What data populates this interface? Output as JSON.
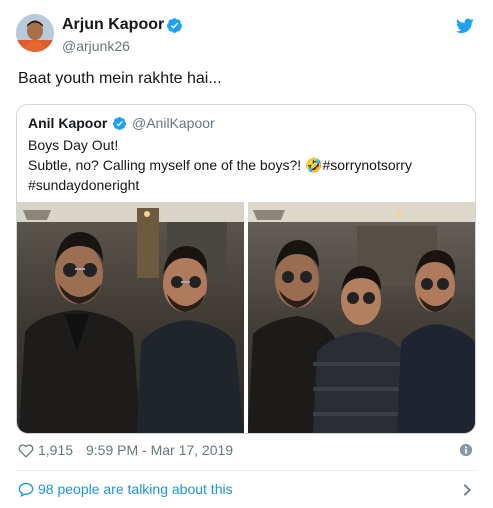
{
  "author": {
    "name": "Arjun Kapoor",
    "handle": "@arjunk26"
  },
  "tweet": {
    "text": "Baat youth mein rakhte hai..."
  },
  "quoted": {
    "name": "Anil Kapoor",
    "handle": "@AnilKapoor",
    "lines": [
      "Boys Day Out!",
      "Subtle, no? Calling myself one of the boys?! 🤣#sorrynotsorry",
      "#sundaydoneright"
    ]
  },
  "footer": {
    "likes": "1,915",
    "timestamp": "9:59 PM - Mar 17, 2019",
    "talking": "98 people are talking about this"
  },
  "icons": {
    "brand": "twitter-bird-icon",
    "verified": "verified-badge-icon",
    "like": "heart-icon",
    "info": "info-icon",
    "reply": "speech-bubble-icon",
    "chevron": "chevron-right-icon"
  },
  "colors": {
    "accent": "#1da1f2",
    "link": "#1b95e0",
    "secondary": "#657786",
    "border": "#ccd6dd"
  }
}
